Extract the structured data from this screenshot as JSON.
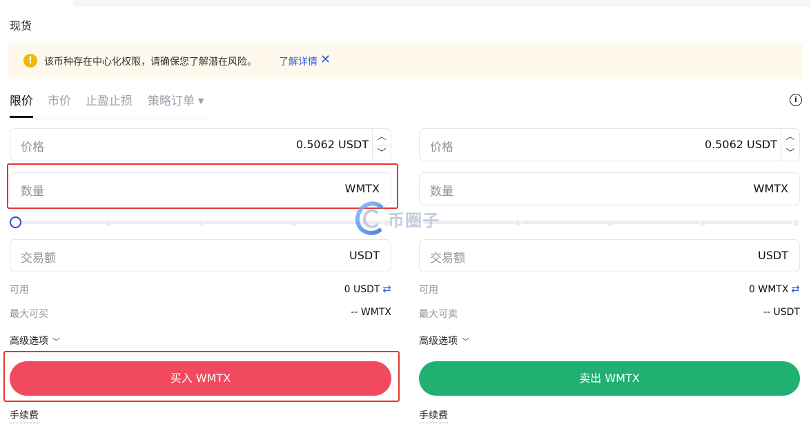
{
  "section_title": "现货",
  "notice": {
    "icon": "warning-icon",
    "message": "该币种存在中心化权限，请确保您了解潜在风险。",
    "link": "了解详情",
    "close": "✕"
  },
  "tabs": {
    "limit": "限价",
    "market": "市价",
    "tpsl": "止盈止损",
    "strategy": "策略订单"
  },
  "buy": {
    "price_label": "价格",
    "price_value": "0.5062 USDT",
    "amount_label": "数量",
    "amount_unit": "WMTX",
    "total_label": "交易额",
    "total_unit": "USDT",
    "available_label": "可用",
    "available_value": "0 USDT",
    "max_label": "最大可买",
    "max_value": "-- WMTX",
    "advanced_label": "高级选项",
    "button_label": "买入 WMTX",
    "fee_label": "手续费"
  },
  "sell": {
    "price_label": "价格",
    "price_value": "0.5062 USDT",
    "amount_label": "数量",
    "amount_unit": "WMTX",
    "total_label": "交易额",
    "total_unit": "USDT",
    "available_label": "可用",
    "available_value": "0 WMTX",
    "max_label": "最大可卖",
    "max_value": "-- USDT",
    "advanced_label": "高级选项",
    "button_label": "卖出 WMTX",
    "fee_label": "手续费"
  },
  "slider_level": 0,
  "watermark": "币圈子",
  "colors": {
    "buy": "#f14a5f",
    "sell": "#1fb072",
    "link": "#2b5fd9",
    "highlight": "#e3372f"
  }
}
